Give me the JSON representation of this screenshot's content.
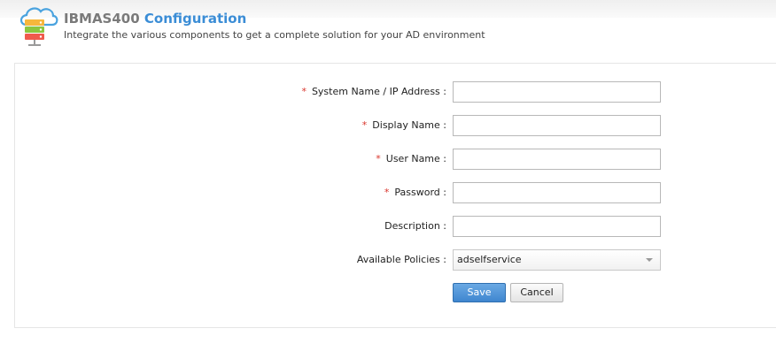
{
  "header": {
    "title_part1": "IBMAS400",
    "title_part2": "Configuration",
    "subtitle": "Integrate the various components to get a complete solution for your AD environment",
    "logo_icon": "cloud-server-icon"
  },
  "form": {
    "required_mark": "*",
    "fields": [
      {
        "label": "System Name / IP Address :",
        "required": true,
        "value": ""
      },
      {
        "label": "Display Name :",
        "required": true,
        "value": ""
      },
      {
        "label": "User Name :",
        "required": true,
        "value": ""
      },
      {
        "label": "Password :",
        "required": true,
        "value": ""
      },
      {
        "label": "Description :",
        "required": false,
        "value": ""
      }
    ],
    "policies": {
      "label": "Available Policies :",
      "selected": "adselfservice"
    },
    "save_label": "Save",
    "cancel_label": "Cancel"
  },
  "colors": {
    "accent": "#3b8dd6",
    "required": "#d9342b",
    "save_button": "#4a8fd6"
  }
}
